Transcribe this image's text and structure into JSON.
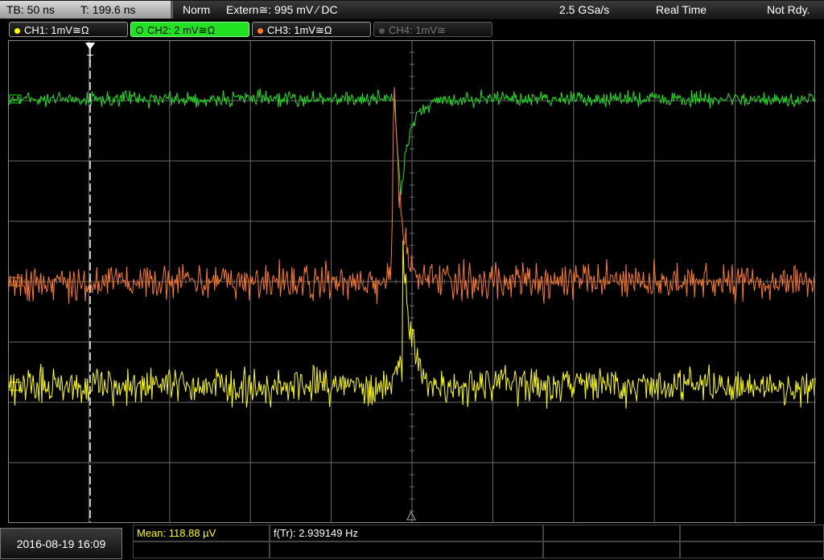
{
  "topbar": {
    "timebase": "TB: 50 ns",
    "trigger_time": "T: 199.6 ns",
    "mode": "Norm",
    "trigger_source": "Extern≅: 995 mV ⁄ DC",
    "sample_rate": "2.5 GSa/s",
    "acq_mode": "Real Time",
    "status": "Not Rdy."
  },
  "channels": [
    {
      "label": "CH1: 1mV≅Ω",
      "color": "#ffff00",
      "active": false,
      "enabled": true
    },
    {
      "label": "CH2: 2 mV≅Ω",
      "color": "#22e022",
      "active": true,
      "enabled": true
    },
    {
      "label": "CH3: 1mV≅Ω",
      "color": "#ff7a2a",
      "active": false,
      "enabled": true
    },
    {
      "label": "CH4: 1mV≅",
      "color": "#777777",
      "active": false,
      "enabled": false
    }
  ],
  "trigger_marker": "T",
  "bottom": {
    "datetime": "2016-08-19 16:09",
    "measurements": [
      {
        "label": "Mean:",
        "value": "118.88 µV",
        "color": "#ffff00"
      },
      {
        "label": "f(Tr):",
        "value": "2.939149 Hz",
        "color": "#ffffff"
      }
    ]
  },
  "colors": {
    "ch1": "#ffff00",
    "ch2": "#22e022",
    "ch3": "#ff7a2a",
    "grid": "#6a6a6a"
  }
}
